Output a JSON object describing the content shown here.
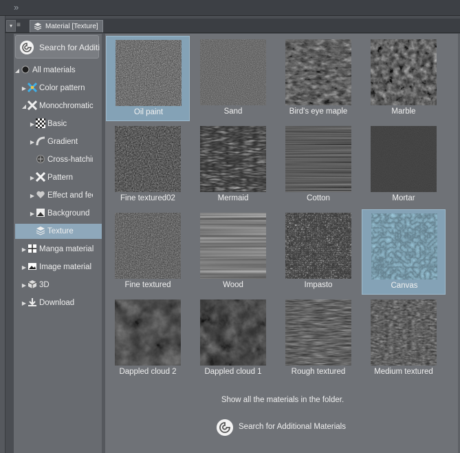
{
  "palette": {
    "tab_title": "Material [Texture]"
  },
  "sidebar": {
    "search_label": "Search for Additi...",
    "tree": [
      {
        "label": "All materials",
        "icon": "disc-icon",
        "expanded": true
      },
      {
        "label": "Color pattern",
        "icon": "color-pattern-icon",
        "expanded": false
      },
      {
        "label": "Monochromatic pattern",
        "icon": "monochromatic-icon",
        "expanded": true
      },
      {
        "label": "Basic",
        "icon": "checker-icon",
        "expanded": false
      },
      {
        "label": "Gradient",
        "icon": "gradient-icon",
        "expanded": false
      },
      {
        "label": "Cross-hatching",
        "icon": "crosshatch-icon"
      },
      {
        "label": "Pattern",
        "icon": "pattern-icon",
        "expanded": false
      },
      {
        "label": "Effect and feeling",
        "icon": "heart-icon",
        "expanded": false
      },
      {
        "label": "Background",
        "icon": "background-icon",
        "expanded": false
      },
      {
        "label": "Texture",
        "icon": "texture-icon",
        "selected": true
      },
      {
        "label": "Manga material",
        "icon": "manga-icon",
        "expanded": false
      },
      {
        "label": "Image material",
        "icon": "image-icon",
        "expanded": false
      },
      {
        "label": "3D",
        "icon": "cube-icon",
        "expanded": false
      },
      {
        "label": "Download",
        "icon": "download-icon",
        "expanded": false
      }
    ]
  },
  "materials": [
    {
      "name": "Oil paint",
      "selected": true
    },
    {
      "name": "Sand"
    },
    {
      "name": "Bird's eye maple"
    },
    {
      "name": "Marble"
    },
    {
      "name": "Fine textured02"
    },
    {
      "name": "Mermaid"
    },
    {
      "name": "Cotton"
    },
    {
      "name": "Mortar"
    },
    {
      "name": "Fine textured"
    },
    {
      "name": "Wood"
    },
    {
      "name": "Impasto"
    },
    {
      "name": "Canvas",
      "selected": true
    },
    {
      "name": "Dappled cloud 2"
    },
    {
      "name": "Dappled cloud 1"
    },
    {
      "name": "Rough textured"
    },
    {
      "name": "Medium textured"
    }
  ],
  "footer": {
    "show_all": "Show all the materials in the folder.",
    "search_additional": "Search for Additional Materials"
  }
}
